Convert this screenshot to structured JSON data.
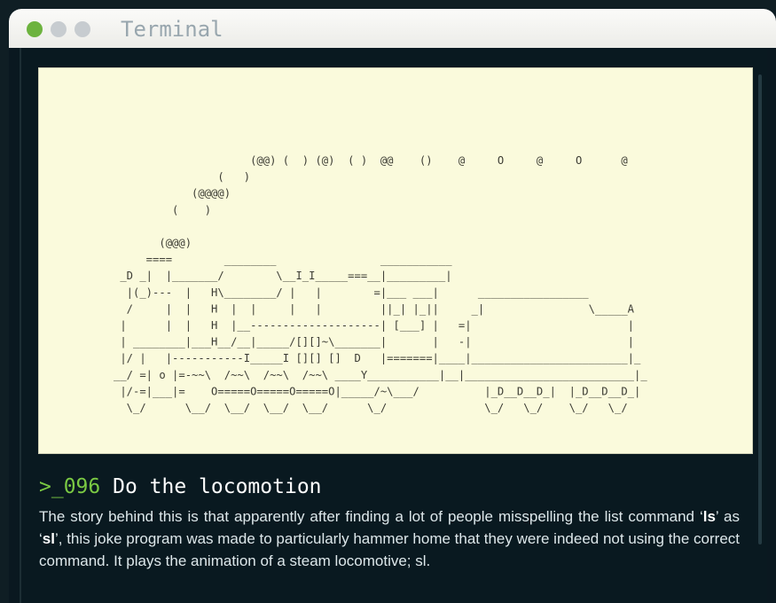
{
  "window": {
    "title": "Terminal",
    "colors": {
      "close": "#6db33f",
      "minimize": "#c7ccd0",
      "zoom": "#c7ccd0",
      "screen": "#091920",
      "prompt": "#7ac943"
    }
  },
  "terminal_output": {
    "lines": [
      "                     (@@) (  ) (@)  ( )  @@    ()    @     O     @     O      @",
      "                (   )",
      "            (@@@@)",
      "         (    )",
      "",
      "       (@@@)",
      "     ====        ________                ___________",
      " _D _|  |_______/        \\__I_I_____===__|_________|",
      "  |(_)---  |   H\\________/ |   |        =|___ ___|      _________________",
      "  /     |  |   H  |  |     |   |         ||_| |_||     _|                \\_____A",
      " |      |  |   H  |__--------------------| [___] |   =|                        |",
      " | ________|___H__/__|_____/[][]~\\_______|       |   -|                        |",
      " |/ |   |-----------I_____I [][] []  D   |=======|____|________________________|_",
      "__/ =| o |=-~~\\  /~~\\  /~~\\  /~~\\ ____Y___________|__|__________________________|_",
      " |/-=|___|=    O=====O=====O=====O|_____/~\\___/          |_D__D__D_|  |_D__D__D_|",
      "  \\_/      \\__/  \\__/  \\__/  \\__/      \\_/               \\_/   \\_/    \\_/   \\_/"
    ]
  },
  "article": {
    "prompt": ">_096",
    "heading": "Do the locomotion",
    "desc_part1": "The story behind this is that apparently after finding a lot of people misspelling the list command ‘",
    "desc_cmd1": "ls",
    "desc_part2": "’ as ‘",
    "desc_cmd2": "sl",
    "desc_part3": "’, this joke program was made to particularly hammer home that they were indeed not using the correct command. It plays the animation of a steam locomotive; sl."
  }
}
